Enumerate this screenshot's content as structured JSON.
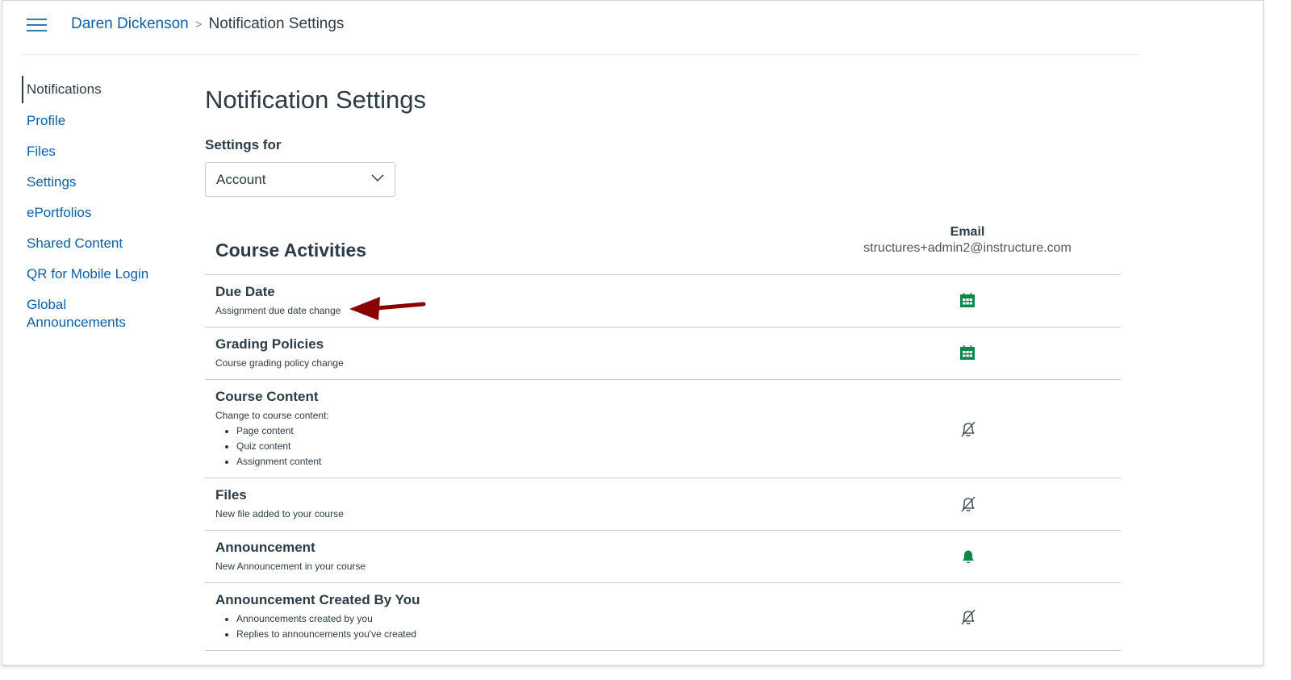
{
  "breadcrumb": {
    "user": "Daren Dickenson",
    "current": "Notification Settings"
  },
  "sidebar": {
    "items": [
      {
        "label": "Notifications"
      },
      {
        "label": "Profile"
      },
      {
        "label": "Files"
      },
      {
        "label": "Settings"
      },
      {
        "label": "ePortfolios"
      },
      {
        "label": "Shared Content"
      },
      {
        "label": "QR for Mobile Login"
      },
      {
        "label": "Global Announcements"
      }
    ]
  },
  "main": {
    "title": "Notification Settings",
    "settings_for_label": "Settings for",
    "settings_for_value": "Account",
    "section_title": "Course Activities",
    "email_header": "Email",
    "email_address": "structures+admin2@instructure.com",
    "rows": [
      {
        "title": "Due Date",
        "desc": "Assignment due date change",
        "icon": "calendar-icon"
      },
      {
        "title": "Grading Policies",
        "desc": "Course grading policy change",
        "icon": "calendar-icon"
      },
      {
        "title": "Course Content",
        "desc": "Change to course content:",
        "bullets": [
          "Page content",
          "Quiz content",
          "Assignment content"
        ],
        "icon": "bell-off-icon"
      },
      {
        "title": "Files",
        "desc": "New file added to your course",
        "icon": "bell-off-icon"
      },
      {
        "title": "Announcement",
        "desc": "New Announcement in your course",
        "icon": "bell-icon"
      },
      {
        "title": "Announcement Created By You",
        "bullets": [
          "Announcements created by you",
          "Replies to announcements you've created"
        ],
        "icon": "bell-off-icon"
      }
    ]
  },
  "colors": {
    "accent": "#0b5ea8",
    "green": "#0b874b",
    "arrow": "#8b0000"
  }
}
